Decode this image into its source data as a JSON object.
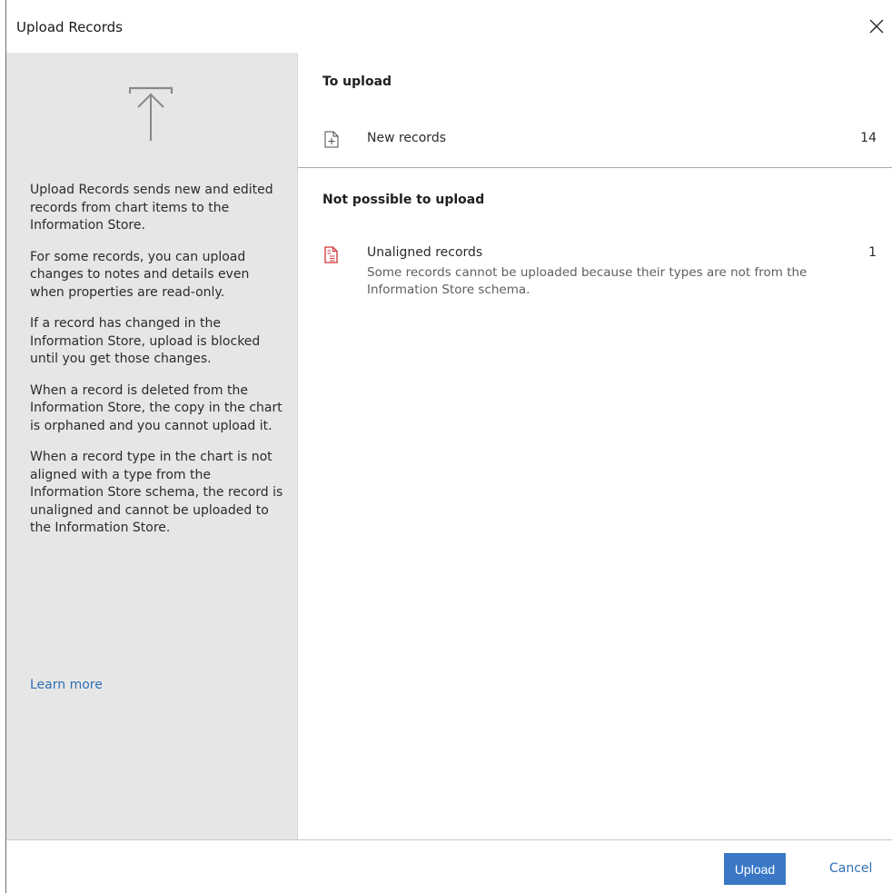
{
  "dialog": {
    "title": "Upload Records",
    "close_icon": "close-icon"
  },
  "sidebar": {
    "icon": "upload-icon",
    "paragraphs": [
      "Upload Records sends new and edited records from chart items to the Information Store.",
      "For some records, you can upload changes to notes and details even when properties are read-only.",
      "If a record has changed in the Information Store, upload is blocked until you get those changes.",
      "When a record is deleted from the Information Store, the copy in the chart is orphaned and you cannot upload it.",
      "When a record type in the chart is not aligned with a type from the Information Store schema, the record is unaligned and cannot be uploaded to the Information Store."
    ],
    "learn_more": "Learn more"
  },
  "to_upload": {
    "heading": "To upload",
    "items": [
      {
        "label": "New records",
        "count": "14",
        "icon": "new-record-icon"
      }
    ]
  },
  "not_possible": {
    "heading": "Not possible to upload",
    "items": [
      {
        "label": "Unaligned records",
        "count": "1",
        "description": "Some records cannot be uploaded because their types are not from the Information Store schema.",
        "icon": "unaligned-record-icon",
        "icon_color": "#d13438"
      }
    ]
  },
  "footer": {
    "upload_label": "Upload",
    "cancel_label": "Cancel",
    "accent": "#3a78c6"
  }
}
